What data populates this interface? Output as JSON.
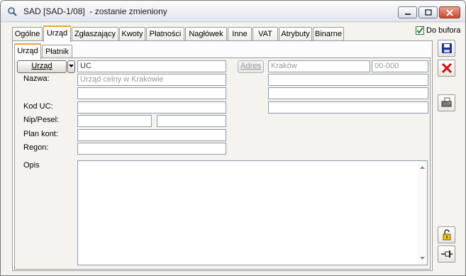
{
  "window": {
    "title": "SAD [SAD-1/08]  - zostanie zmieniony"
  },
  "tabs": [
    {
      "label": "Ogólne"
    },
    {
      "label": "Urząd"
    },
    {
      "label": "Zgłaszający"
    },
    {
      "label": "Kwoty"
    },
    {
      "label": "Płatności"
    },
    {
      "label": "Nagłówek"
    },
    {
      "label": "Inne"
    },
    {
      "label": "VAT"
    },
    {
      "label": "Atrybuty"
    },
    {
      "label": "Binarne"
    }
  ],
  "active_tab": "Urząd",
  "subtabs": [
    {
      "label": "Urząd"
    },
    {
      "label": "Płatnik"
    }
  ],
  "do_bufora": {
    "label": "Do bufora",
    "checked": true
  },
  "form": {
    "urzad_button": "Urząd",
    "code_value": "UC",
    "adres_button": "Adres",
    "city_value": "Kraków",
    "postal_value": "00-000",
    "nazwa_label": "Nazwa:",
    "nazwa_value": "Urząd celny w Krakowie",
    "kod_uc_label": "Kod UC:",
    "nip_label": "Nip/Pesel:",
    "plan_kont_label": "Plan kont:",
    "regon_label": "Regon:",
    "opis_label": "Opis"
  },
  "side_buttons": [
    {
      "icon": "save-icon"
    },
    {
      "icon": "delete-icon"
    },
    {
      "icon": "printer-icon"
    },
    {
      "icon": "unlock-icon"
    },
    {
      "icon": "pin-icon"
    }
  ]
}
